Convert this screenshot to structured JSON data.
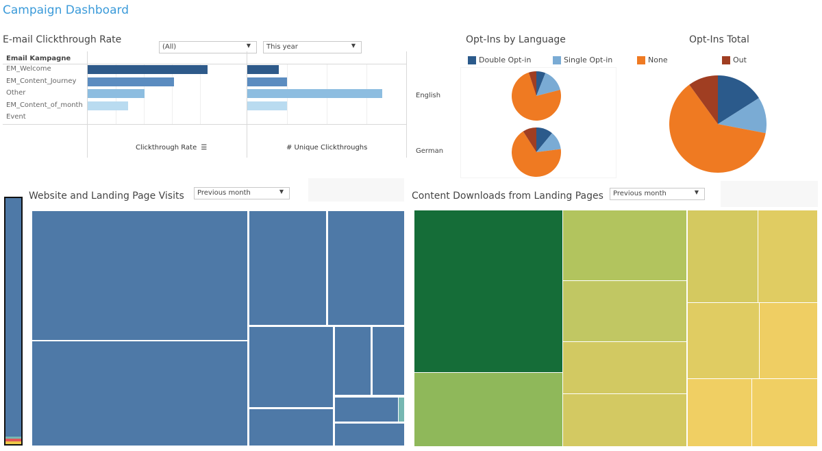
{
  "dashboard": {
    "title": "Campaign Dashboard"
  },
  "email_ctr": {
    "title": "E-mail Clickthrough Rate",
    "filter_campaign": "(All)",
    "filter_period": "This year",
    "row_header": "Email Kampagne",
    "rows": [
      "EM_Welcome",
      "EM_Content_Journey",
      "Other",
      "EM_Content_of_month",
      "Event"
    ],
    "bar_colors": [
      "#2e5a8a",
      "#5b8cc0",
      "#8dbde0",
      "#b9dbf0",
      "#cfe5f3"
    ],
    "measure1": {
      "label": "Clickthrough Rate",
      "sort_icon": "sort-descending-icon",
      "values": [
        4.3,
        3.1,
        2.05,
        1.45,
        0
      ],
      "max": 5.7
    },
    "measure2": {
      "label": "# Unique Clickthroughs",
      "values": [
        0.8,
        1.0,
        3.4,
        1.0,
        0
      ],
      "max": 4.0
    }
  },
  "optins_language": {
    "title": "Opt-Ins by Language",
    "legend": [
      {
        "label": "Double Opt-in",
        "color": "#2b5a8b"
      },
      {
        "label": "Single Opt-in",
        "color": "#7aabd4"
      }
    ],
    "languages": [
      {
        "label": "English",
        "slices": [
          6,
          15,
          74,
          5
        ]
      },
      {
        "label": "German",
        "slices": [
          11,
          12,
          68,
          9
        ]
      }
    ]
  },
  "optins_total": {
    "title": "Opt-Ins Total",
    "legend": [
      {
        "label": "None",
        "color": "#ef7a22"
      },
      {
        "label": "Out",
        "color": "#a03e22"
      }
    ],
    "slices": [
      16,
      12,
      62,
      10
    ]
  },
  "pie_colors": [
    "#2b5a8b",
    "#7aabd4",
    "#ef7a22",
    "#a03e22"
  ],
  "visits": {
    "title": "Website and Landing Page Visits",
    "filter": "Previous month",
    "color": "#4e79a7",
    "accent_color": "#76b7b2"
  },
  "downloads": {
    "title": "Content Downloads from Landing Pages",
    "filter": "Previous month"
  },
  "chart_data": [
    {
      "type": "bar",
      "title": "Clickthrough Rate",
      "categories": [
        "EM_Welcome",
        "EM_Content_Journey",
        "Other",
        "EM_Content_of_month",
        "Event"
      ],
      "values": [
        4.3,
        3.1,
        2.05,
        1.45,
        0
      ],
      "xlabel": "Clickthrough Rate",
      "ylabel": "Email Kampagne"
    },
    {
      "type": "bar",
      "title": "# Unique Clickthroughs",
      "categories": [
        "EM_Welcome",
        "EM_Content_Journey",
        "Other",
        "EM_Content_of_month",
        "Event"
      ],
      "values": [
        0.8,
        1.0,
        3.4,
        1.0,
        0
      ],
      "xlabel": "# Unique Clickthroughs",
      "ylabel": "Email Kampagne"
    },
    {
      "type": "pie",
      "title": "Opt-Ins by Language - English",
      "categories": [
        "Double Opt-in",
        "Single Opt-in",
        "None",
        "Out"
      ],
      "values": [
        6,
        15,
        74,
        5
      ]
    },
    {
      "type": "pie",
      "title": "Opt-Ins by Language - German",
      "categories": [
        "Double Opt-in",
        "Single Opt-in",
        "None",
        "Out"
      ],
      "values": [
        11,
        12,
        68,
        9
      ]
    },
    {
      "type": "pie",
      "title": "Opt-Ins Total",
      "categories": [
        "Double Opt-in",
        "Single Opt-in",
        "None",
        "Out"
      ],
      "values": [
        16,
        12,
        62,
        10
      ]
    }
  ]
}
